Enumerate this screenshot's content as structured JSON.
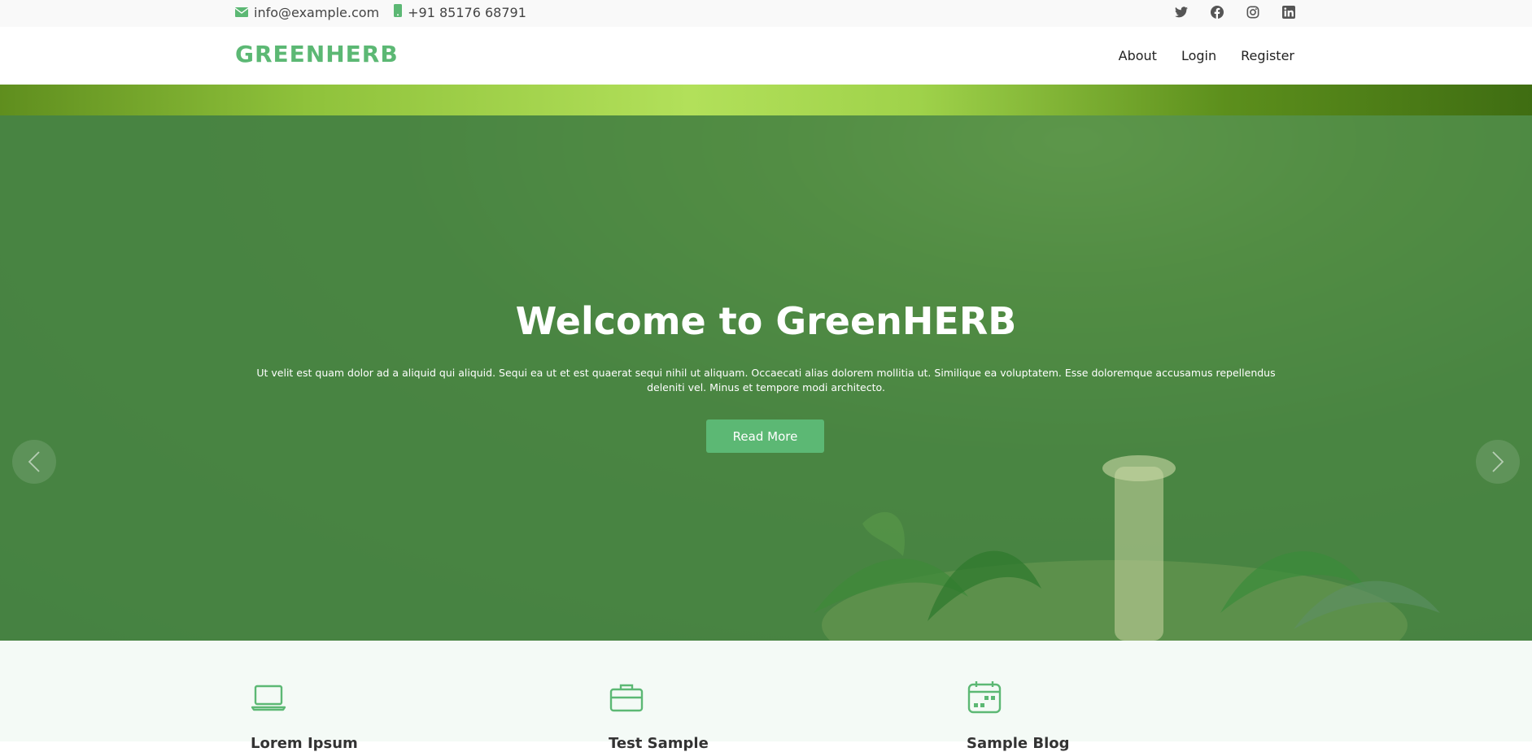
{
  "topbar": {
    "email": "info@example.com",
    "phone": "+91 85176 68791",
    "social": [
      "twitter-icon",
      "facebook-icon",
      "instagram-icon",
      "linkedin-icon"
    ]
  },
  "header": {
    "logo": "GREENHERB",
    "nav": [
      "About",
      "Login",
      "Register"
    ]
  },
  "hero": {
    "title": "Welcome to GreenHERB",
    "text": "Ut velit est quam dolor ad a aliquid qui aliquid. Sequi ea ut et est quaerat sequi nihil ut aliquam. Occaecati alias dolorem mollitia ut. Similique ea voluptatem. Esse doloremque accusamus repellendus deleniti vel. Minus et tempore modi architecto.",
    "button": "Read More"
  },
  "features": [
    {
      "icon": "laptop-icon",
      "title": "Lorem Ipsum"
    },
    {
      "icon": "briefcase-icon",
      "title": "Test Sample"
    },
    {
      "icon": "calendar-icon",
      "title": "Sample Blog"
    }
  ],
  "colors": {
    "accent": "#5cb874",
    "topbar_bg": "#f9f9f9",
    "features_bg": "#f4faf6"
  }
}
